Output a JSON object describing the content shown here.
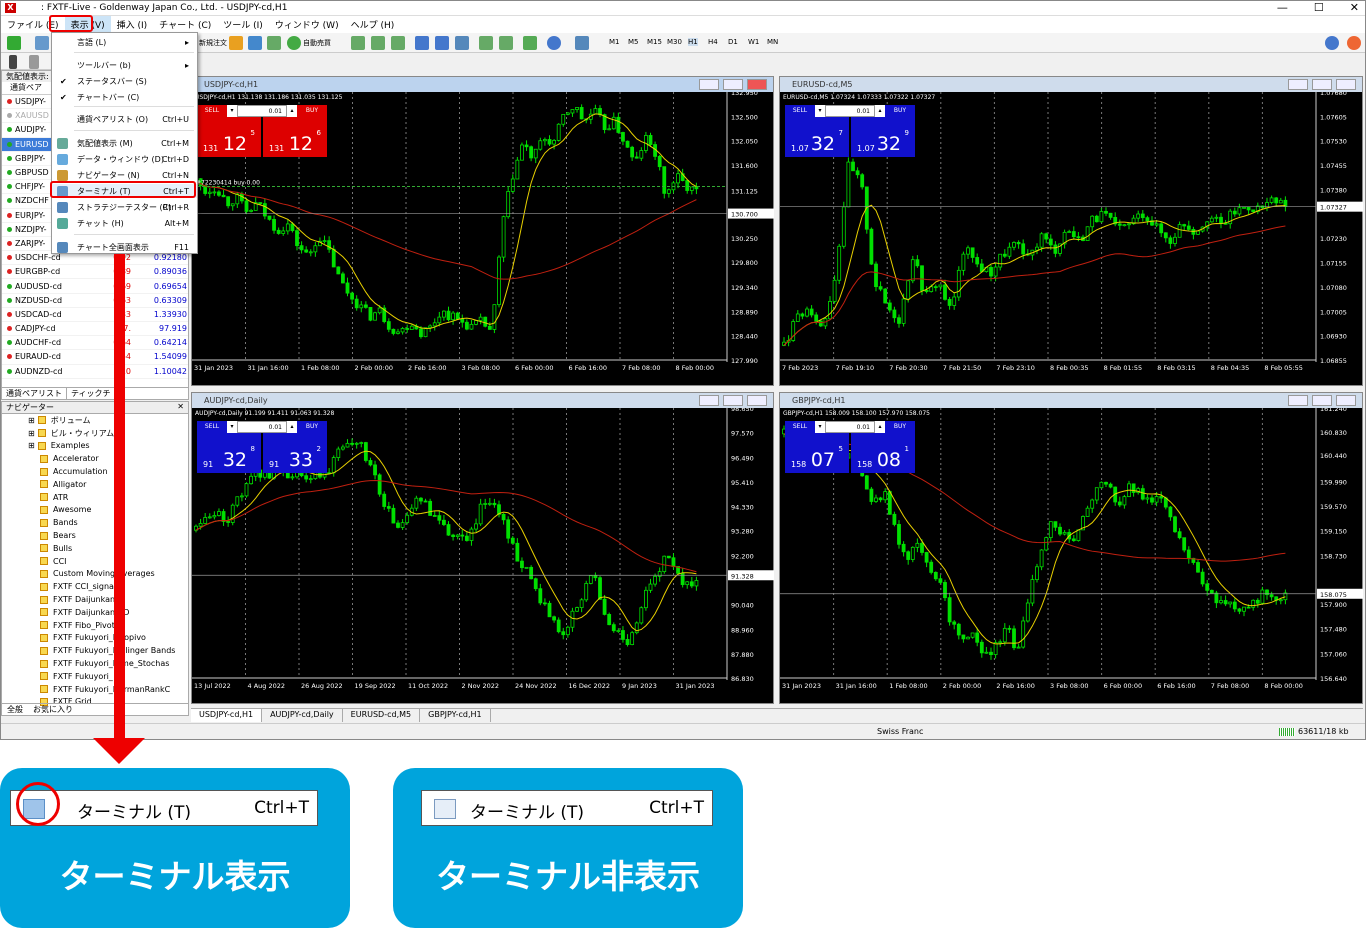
{
  "window": {
    "title": ": FXTF-Live - Goldenway Japan Co., Ltd. - USDJPY-cd,H1",
    "min": "—",
    "max": "☐",
    "close": "✕"
  },
  "menubar": [
    "ファイル (E)",
    "表示 (V)",
    "挿入 (I)",
    "チャート (C)",
    "ツール (I)",
    "ウィンドウ (W)",
    "ヘルプ (H)"
  ],
  "toolbar": {
    "new_order": "新規注文",
    "auto_trade": "自動売買",
    "timeframes": [
      "M1",
      "M5",
      "M15",
      "M30",
      "H1",
      "H4",
      "D1",
      "W1",
      "MN"
    ]
  },
  "view_menu": {
    "items": [
      {
        "label": "言語 (L)",
        "shortcut": "",
        "arrow": "▸"
      },
      {
        "label": "ツールバー (b)",
        "shortcut": "",
        "arrow": "▸"
      },
      {
        "label": "ステータスバー (S)",
        "shortcut": "",
        "check": "✔"
      },
      {
        "label": "チャートバー (C)",
        "shortcut": "",
        "check": "✔"
      },
      {
        "label": "通貨ペアリスト (O)",
        "shortcut": "Ctrl+U"
      },
      {
        "label": "気配値表示 (M)",
        "shortcut": "Ctrl+M"
      },
      {
        "label": "データ・ウィンドウ (D)",
        "shortcut": "Ctrl+D"
      },
      {
        "label": "ナビゲーター (N)",
        "shortcut": "Ctrl+N"
      },
      {
        "label": "ターミナル (T)",
        "shortcut": "Ctrl+T"
      },
      {
        "label": "ストラテジーテスター (R)",
        "shortcut": "Ctrl+R"
      },
      {
        "label": "チャット (H)",
        "shortcut": "Alt+M"
      },
      {
        "label": "チャート全画面表示",
        "shortcut": "F11"
      }
    ]
  },
  "market_watch": {
    "title": "気配値表示: 12:5",
    "header": "通貨ペア",
    "rows": [
      {
        "sym": "USDJPY-",
        "bid": "",
        "ask": "",
        "color": "#d22"
      },
      {
        "sym": "XAUUSD",
        "bid": "",
        "ask": "",
        "color": "#aaa"
      },
      {
        "sym": "AUDJPY-",
        "bid": "",
        "ask": "",
        "color": "#2a2"
      },
      {
        "sym": "EURUSD",
        "bid": "",
        "ask": "",
        "color": "#2a2"
      },
      {
        "sym": "GBPJPY-",
        "bid": "",
        "ask": "",
        "color": "#2a2"
      },
      {
        "sym": "GBPUSD",
        "bid": "",
        "ask": "",
        "color": "#2a2"
      },
      {
        "sym": "CHFJPY-",
        "bid": "",
        "ask": "",
        "color": "#2a2"
      },
      {
        "sym": "NZDCHF",
        "bid": "",
        "ask": "",
        "color": "#2a2"
      },
      {
        "sym": "EURJPY-",
        "bid": "",
        "ask": "",
        "color": "#d22"
      },
      {
        "sym": "NZDJPY-",
        "bid": "",
        "ask": "",
        "color": "#2a2"
      },
      {
        "sym": "ZARJPY-",
        "bid": "",
        "ask": "",
        "color": "#d22"
      },
      {
        "sym": "USDCHF-cd",
        "bid": "0.92",
        "ask": "0.92180",
        "color": "#d22"
      },
      {
        "sym": "EURGBP-cd",
        "bid": "0.89",
        "ask": "0.89036",
        "color": "#d22"
      },
      {
        "sym": "AUDUSD-cd",
        "bid": "0.69",
        "ask": "0.69654",
        "color": "#2a2"
      },
      {
        "sym": "NZDUSD-cd",
        "bid": "0.63",
        "ask": "0.63309",
        "color": "#2a2"
      },
      {
        "sym": "USDCAD-cd",
        "bid": "1.33",
        "ask": "1.33930",
        "color": "#d22"
      },
      {
        "sym": "CADJPY-cd",
        "bid": "97.",
        "ask": "97.919",
        "color": "#d22"
      },
      {
        "sym": "AUDCHF-cd",
        "bid": "0.64",
        "ask": "0.64214",
        "color": "#2a2"
      },
      {
        "sym": "EURAUD-cd",
        "bid": "1.54",
        "ask": "1.54099",
        "color": "#d22"
      },
      {
        "sym": "AUDNZD-cd",
        "bid": "1.10",
        "ask": "1.10042",
        "color": "#2a2"
      }
    ],
    "tabs": [
      "通貨ペアリスト",
      "ティックチ"
    ]
  },
  "navigator": {
    "title": "ナビゲーター",
    "items": [
      "ボリューム",
      "ビル・ウィリアムス",
      "Examples",
      "Accelerator",
      "Accumulation",
      "Alligator",
      "ATR",
      "Awesome",
      "Bands",
      "Bears",
      "Bulls",
      "CCI",
      "Custom Moving Averages",
      "FXTF CCI_signal",
      "FXTF Daijunkan",
      "FXTF Daijunkan CD",
      "FXTF Fibo_Pivot",
      "FXTF Fukuyori_Fibopivo",
      "FXTF Fukuyori_Bollinger Bands",
      "FXTF Fukuyori_Hime_Stochas",
      "FXTF Fukuyori_",
      "FXTF Fukuyori_HarmanRankC",
      "FXTF Grid"
    ],
    "tabs": [
      "全般",
      "お気に入り"
    ]
  },
  "charts": [
    {
      "title": "USDJPY-cd,H1",
      "info": "USDJPY-cd,H1  131.138 131.186 131.035 131.125",
      "sell_small": "131",
      "sell_big": "12",
      "sell_sup": "5",
      "buy_small": "131",
      "buy_big": "12",
      "buy_sup": "6",
      "lot": "0.01",
      "panel_color": "#d00",
      "axis": [
        "132.950",
        "132.500",
        "132.050",
        "131.600",
        "131.125",
        "130.700",
        "130.250",
        "129.800",
        "129.340",
        "128.890",
        "128.440",
        "127.990"
      ],
      "times": [
        "31 Jan 2023",
        "31 Jan 16:00",
        "1 Feb 08:00",
        "2 Feb 00:00",
        "2 Feb 16:00",
        "3 Feb 08:00",
        "6 Feb 00:00",
        "6 Feb 16:00",
        "7 Feb 08:00",
        "8 Feb 00:00"
      ],
      "order": "#72230414 buy 0.00",
      "price": [
        131.3,
        131.1,
        131.2,
        130.9,
        131.0,
        130.7,
        130.9,
        130.6,
        130.4,
        130.5,
        130.1,
        129.9,
        130.3,
        130.0,
        129.5,
        129.2,
        129.0,
        128.8,
        128.9,
        128.6,
        128.5,
        128.7,
        128.5,
        128.6,
        128.9,
        128.8,
        128.7,
        128.6,
        128.7,
        128.5,
        130.5,
        131.4,
        132.0,
        131.7,
        132.1,
        132.0,
        132.5,
        132.7,
        132.4,
        132.6,
        132.3,
        132.4,
        132.0,
        131.6,
        132.1,
        131.8,
        131.0,
        131.4,
        131.2,
        131.1
      ],
      "sel": 0
    },
    {
      "title": "EURUSD-cd,M5",
      "info": "EURUSD-cd,M5  1.07324 1.07333 1.07322 1.07327",
      "sell_small": "1.07",
      "sell_big": "32",
      "sell_sup": "7",
      "buy_small": "1.07",
      "buy_big": "32",
      "buy_sup": "9",
      "lot": "0.01",
      "panel_color": "#11c",
      "axis": [
        "1.07680",
        "1.07605",
        "1.07530",
        "1.07455",
        "1.07380",
        "1.07327",
        "1.07230",
        "1.07155",
        "1.07080",
        "1.07005",
        "1.06930",
        "1.06855"
      ],
      "times": [
        "7 Feb 2023",
        "7 Feb 19:10",
        "7 Feb 20:30",
        "7 Feb 21:50",
        "7 Feb 23:10",
        "8 Feb 00:35",
        "8 Feb 01:55",
        "8 Feb 03:15",
        "8 Feb 04:35",
        "8 Feb 05:55"
      ],
      "order": "",
      "price": [
        1.069,
        1.0698,
        1.0702,
        1.0695,
        1.0712,
        1.0745,
        1.074,
        1.071,
        1.0702,
        1.0698,
        1.0718,
        1.0705,
        1.071,
        1.07,
        1.072,
        1.0715,
        1.0712,
        1.0718,
        1.0721,
        1.0716,
        1.0724,
        1.0719,
        1.0726,
        1.0722,
        1.0729,
        1.073,
        1.0725,
        1.0728,
        1.0731,
        1.0726,
        1.0722,
        1.0728,
        1.0725,
        1.073,
        1.0727,
        1.0731,
        1.0733,
        1.0732,
        1.0734,
        1.0733
      ],
      "sel": 0
    },
    {
      "title": "AUDJPY-cd,Daily",
      "info": "AUDJPY-cd,Daily  91.199 91.411 91.063 91.328",
      "sell_small": "91",
      "sell_big": "32",
      "sell_sup": "8",
      "buy_small": "91",
      "buy_big": "33",
      "buy_sup": "2",
      "lot": "0.01",
      "panel_color": "#11c",
      "axis": [
        "98.650",
        "97.570",
        "96.490",
        "95.410",
        "94.330",
        "93.280",
        "92.200",
        "91.328",
        "90.040",
        "88.960",
        "87.880",
        "86.830"
      ],
      "times": [
        "13 Jul 2022",
        "4 Aug 2022",
        "26 Aug 2022",
        "19 Sep 2022",
        "11 Oct 2022",
        "2 Nov 2022",
        "24 Nov 2022",
        "16 Dec 2022",
        "9 Jan 2023",
        "31 Jan 2023"
      ],
      "order": "",
      "price": [
        93.3,
        93.8,
        94.0,
        93.6,
        94.6,
        95.2,
        95.9,
        95.7,
        96.2,
        95.8,
        95.9,
        95.4,
        95.8,
        96.0,
        96.7,
        96.9,
        97.1,
        96.2,
        95.0,
        93.9,
        93.4,
        94.2,
        94.7,
        94.0,
        93.5,
        93.1,
        92.8,
        93.3,
        94.4,
        94.8,
        93.7,
        92.6,
        91.7,
        91.0,
        90.0,
        89.4,
        88.6,
        89.8,
        90.7,
        91.4,
        89.4,
        89.0,
        88.3,
        88.9,
        90.5,
        91.2,
        92.1,
        91.5,
        90.8,
        91.3
      ],
      "sel": 0
    },
    {
      "title": "GBPJPY-cd,H1",
      "info": "GBPJPY-cd,H1  158.009 158.100 157.970 158.075",
      "sell_small": "158",
      "sell_big": "07",
      "sell_sup": "5",
      "buy_small": "158",
      "buy_big": "08",
      "buy_sup": "1",
      "lot": "0.01",
      "panel_color": "#11c",
      "axis": [
        "161.240",
        "160.830",
        "160.440",
        "159.990",
        "159.570",
        "159.150",
        "158.730",
        "158.075",
        "157.900",
        "157.480",
        "157.060",
        "156.640"
      ],
      "times": [
        "31 Jan 2023",
        "31 Jan 16:00",
        "1 Feb 08:00",
        "2 Feb 00:00",
        "2 Feb 16:00",
        "3 Feb 08:00",
        "6 Feb 00:00",
        "6 Feb 16:00",
        "7 Feb 08:00",
        "8 Feb 00:00"
      ],
      "order": "",
      "price": [
        160.8,
        160.6,
        160.9,
        160.5,
        160.7,
        160.3,
        160.6,
        160.1,
        159.6,
        159.8,
        159.1,
        158.7,
        159.0,
        158.4,
        158.2,
        157.6,
        157.3,
        157.4,
        157.0,
        157.2,
        157.5,
        157.1,
        158.0,
        158.8,
        159.4,
        159.1,
        159.0,
        159.5,
        159.9,
        160.0,
        159.6,
        159.9,
        159.8,
        159.7,
        159.6,
        159.2,
        158.7,
        158.5,
        158.1,
        157.9,
        158.0,
        157.7,
        157.9,
        158.1,
        158.0,
        158.05
      ],
      "sel": 0
    }
  ],
  "chart_tabs": [
    "USDJPY-cd,H1",
    "AUDJPY-cd,Daily",
    "EURUSD-cd,M5",
    "GBPJPY-cd,H1"
  ],
  "status": {
    "center": "Swiss Franc",
    "right": "63611/18 kb"
  },
  "cards": [
    {
      "item": "ターミナル (T)",
      "shortcut": "Ctrl+T",
      "caption": "ターミナル表示"
    },
    {
      "item": "ターミナル (T)",
      "shortcut": "Ctrl+T",
      "caption": "ターミナル非表示"
    }
  ]
}
